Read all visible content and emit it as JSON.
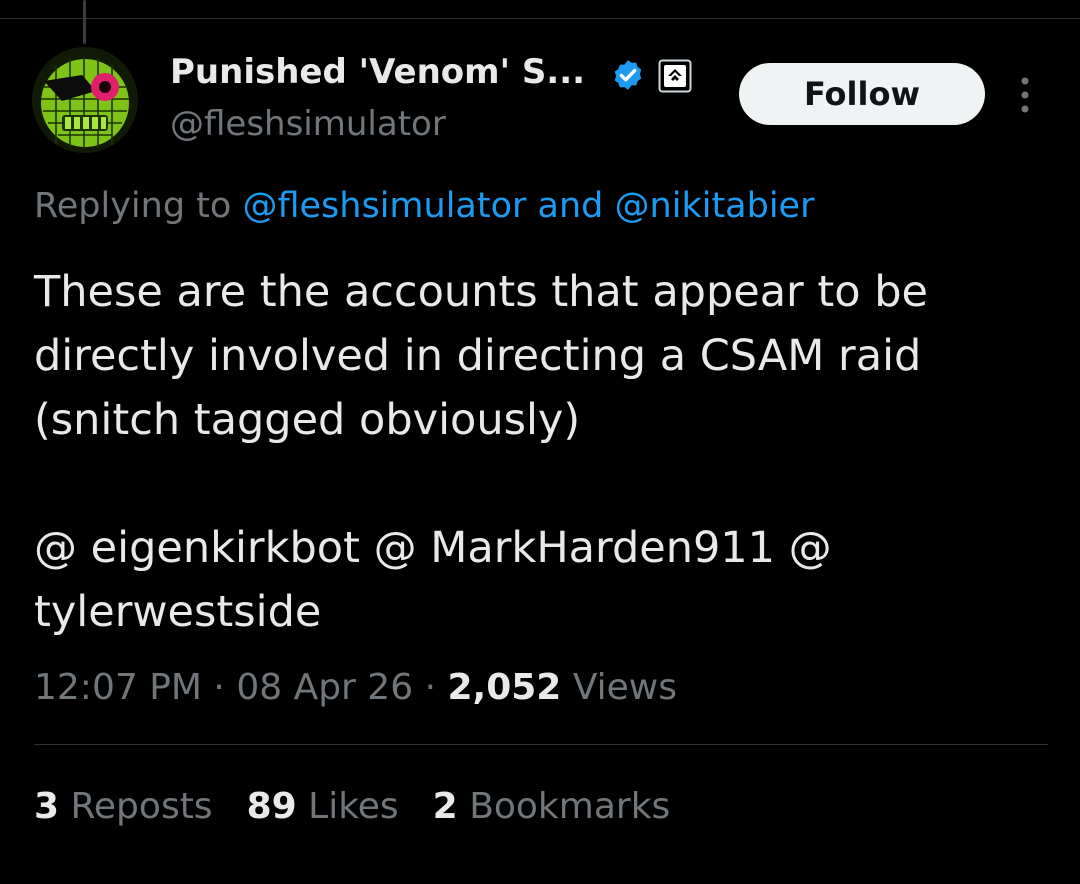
{
  "author": {
    "display_name": "Punished 'Venom' S...",
    "handle": "@fleshsimulator",
    "verified": true,
    "avatar_icon": "green-skull-eyepatch-avatar",
    "colors": {
      "verified": "#1d9bf0"
    }
  },
  "actions": {
    "follow_label": "Follow",
    "more_icon": "more-vertical-icon"
  },
  "reply": {
    "prefix": "Replying to",
    "mention_1": "@fleshsimulator",
    "conjunction": "and",
    "mention_2": "@nikitabier"
  },
  "tweet": {
    "lines": [
      "These are the accounts that appear to be",
      "directly involved in directing a CSAM raid",
      "(snitch tagged obviously)",
      "",
      "@ eigenkirkbot @ MarkHarden911 @",
      "tylerwestside"
    ]
  },
  "meta": {
    "time": "12:07 PM",
    "sep1": "·",
    "date": "08 Apr 26",
    "sep2": "·",
    "views_count": "2,052",
    "views_label": "Views"
  },
  "stats": [
    {
      "count": "3",
      "label": "Reposts"
    },
    {
      "count": "89",
      "label": "Likes"
    },
    {
      "count": "2",
      "label": "Bookmarks"
    }
  ],
  "theme": {
    "background": "#000000",
    "text": "#e7e9ea",
    "muted": "#71767b",
    "link": "#1d9bf0"
  }
}
